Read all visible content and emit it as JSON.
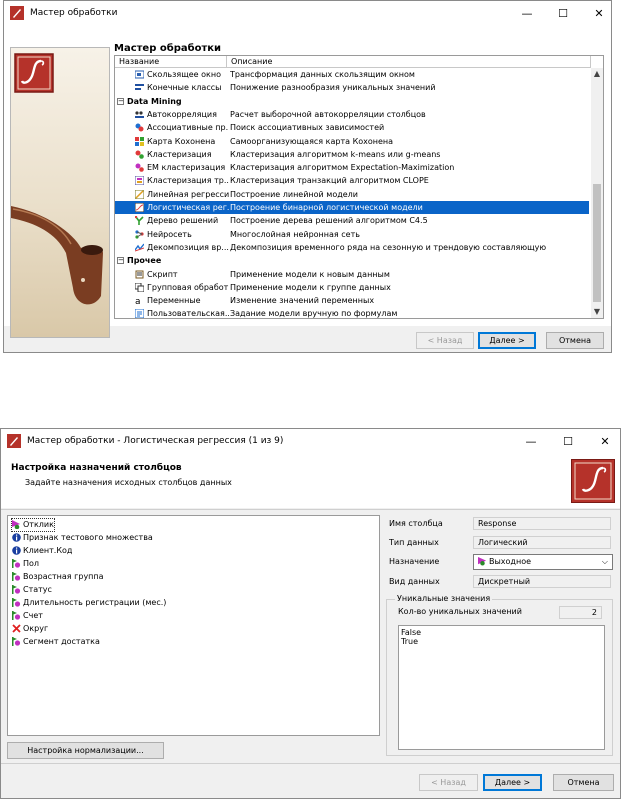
{
  "window1": {
    "title": "Мастер обработки",
    "heading": "Мастер обработки",
    "columns": {
      "name": "Название",
      "desc": "Описание"
    },
    "rows": [
      {
        "kind": "item",
        "name": "Скользящее окно",
        "desc": "Трансформация данных скользящим окном",
        "icon": "sliding-window-icon"
      },
      {
        "kind": "item",
        "name": "Конечные классы",
        "desc": "Понижение разнообразия уникальных значений",
        "icon": "finite-classes-icon"
      },
      {
        "kind": "group",
        "name": "Data Mining",
        "toggle": "−"
      },
      {
        "kind": "item",
        "name": "Автокорреляция",
        "desc": "Расчет выборочной автокорреляции столбцов",
        "icon": "autocorrelation-icon"
      },
      {
        "kind": "item",
        "name": "Ассоциативные пр...",
        "desc": "Поиск ассоциативных зависимостей",
        "icon": "association-rules-icon"
      },
      {
        "kind": "item",
        "name": "Карта Кохонена",
        "desc": "Самоорганизующаяся карта Кохонена",
        "icon": "kohonen-map-icon"
      },
      {
        "kind": "item",
        "name": "Кластеризация",
        "desc": "Кластеризация алгоритмом k-means или g-means",
        "icon": "clustering-icon"
      },
      {
        "kind": "item",
        "name": "EM кластеризация",
        "desc": "Кластеризация алгоритмом Expectation-Maximization",
        "icon": "em-clustering-icon"
      },
      {
        "kind": "item",
        "name": "Кластеризация тр...",
        "desc": "Кластеризация транзакций алгоритмом CLOPE",
        "icon": "transaction-clustering-icon"
      },
      {
        "kind": "item",
        "name": "Линейная регрессия",
        "desc": "Построение линейной модели",
        "icon": "linear-regression-icon"
      },
      {
        "kind": "item",
        "name": "Логистическая рег...",
        "desc": "Построение бинарной логистической модели",
        "icon": "logistic-regression-icon",
        "selected": true
      },
      {
        "kind": "item",
        "name": "Дерево решений",
        "desc": "Построение дерева решений алгоритмом C4.5",
        "icon": "decision-tree-icon"
      },
      {
        "kind": "item",
        "name": "Нейросеть",
        "desc": "Многослойная нейронная сеть",
        "icon": "neural-network-icon"
      },
      {
        "kind": "item",
        "name": "Декомпозиция вр...",
        "desc": "Декомпозиция временного ряда на сезонную и трендовую составляющую",
        "icon": "decomposition-icon"
      },
      {
        "kind": "group",
        "name": "Прочее",
        "toggle": "−"
      },
      {
        "kind": "item",
        "name": "Скрипт",
        "desc": "Применение модели к новым данным",
        "icon": "script-icon"
      },
      {
        "kind": "item",
        "name": "Групповая обработ...",
        "desc": "Применение модели к группе данных",
        "icon": "group-processing-icon"
      },
      {
        "kind": "item",
        "name": "Переменные",
        "desc": "Изменение значений переменных",
        "icon": "variables-icon"
      },
      {
        "kind": "item",
        "name": "Пользовательская...",
        "desc": "Задание модели вручную по формулам",
        "icon": "user-model-icon"
      }
    ],
    "buttons": {
      "back": "< Назад",
      "next": "Далее >",
      "cancel": "Отмена"
    }
  },
  "window2": {
    "title": "Мастер обработки - Логистическая регрессия (1 из 9)",
    "heading": "Настройка назначений столбцов",
    "subheading": "Задайте назначения исходных столбцов данных",
    "columns": [
      {
        "name": "Отклик",
        "icon": "output-column-icon",
        "selected": true
      },
      {
        "name": "Признак тестового множества",
        "icon": "info-column-icon"
      },
      {
        "name": "Клиент.Код",
        "icon": "info-column-icon"
      },
      {
        "name": "Пол",
        "icon": "input-column-icon"
      },
      {
        "name": "Возрастная группа",
        "icon": "input-column-icon"
      },
      {
        "name": "Статус",
        "icon": "input-column-icon"
      },
      {
        "name": "Длительность регистрации (мес.)",
        "icon": "input-column-icon"
      },
      {
        "name": "Счет",
        "icon": "input-column-icon"
      },
      {
        "name": "Округ",
        "icon": "unused-column-icon"
      },
      {
        "name": "Сегмент достатка",
        "icon": "input-column-icon"
      }
    ],
    "normalize_button": "Настройка нормализации...",
    "props": {
      "col_name_label": "Имя столбца",
      "col_name": "Response",
      "data_type_label": "Тип данных",
      "data_type": "Логический",
      "purpose_label": "Назначение",
      "purpose": "Выходное",
      "kind_label": "Вид данных",
      "kind": "Дискретный"
    },
    "unique": {
      "group_label": "Уникальные значения",
      "count_label": "Кол-во уникальных значений",
      "count": "2",
      "values": [
        "False",
        "True"
      ]
    },
    "buttons": {
      "back": "< Назад",
      "next": "Далее >",
      "cancel": "Отмена"
    }
  },
  "colors": {
    "selection": "#0a64c8",
    "accent_button": "#0078d7",
    "logo_red": "#b5322a"
  }
}
